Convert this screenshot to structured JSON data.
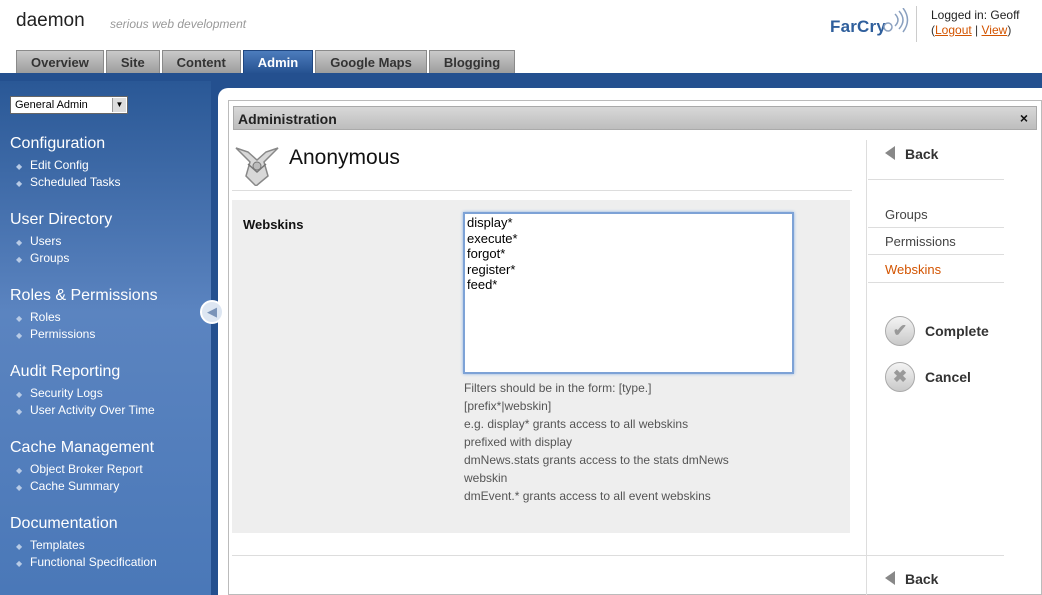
{
  "header": {
    "brand": "daemon",
    "tagline": "serious web development",
    "farcry_logo": "FarCry",
    "login": {
      "label": "Logged in: Geoff",
      "logout": "Logout",
      "view": "View"
    }
  },
  "tabs": [
    {
      "label": "Overview"
    },
    {
      "label": "Site"
    },
    {
      "label": "Content"
    },
    {
      "label": "Admin",
      "active": true
    },
    {
      "label": "Google Maps"
    },
    {
      "label": "Blogging"
    }
  ],
  "sidebar": {
    "select_value": "General Admin",
    "sections": [
      {
        "title": "Configuration",
        "items": [
          "Edit Config",
          "Scheduled Tasks"
        ]
      },
      {
        "title": "User Directory",
        "items": [
          "Users",
          "Groups"
        ]
      },
      {
        "title": "Roles & Permissions",
        "items": [
          "Roles",
          "Permissions"
        ]
      },
      {
        "title": "Audit Reporting",
        "items": [
          "Security Logs",
          "User Activity Over Time"
        ]
      },
      {
        "title": "Cache Management",
        "items": [
          "Object Broker Report",
          "Cache Summary"
        ]
      },
      {
        "title": "Documentation",
        "items": [
          "Templates",
          "Functional Specification"
        ]
      }
    ]
  },
  "admin": {
    "title": "Administration",
    "close": "×",
    "user_name": "Anonymous"
  },
  "form": {
    "field_label": "Webskins",
    "textarea_value": "display*\nexecute*\nforgot*\nregister*\nfeed*",
    "hint_lines": [
      "Filters should be in the form: [type.]",
      "[prefix*|webskin]",
      "e.g. display* grants access to all webskins",
      "prefixed with display",
      "dmNews.stats grants access to the stats dmNews",
      "webskin",
      "dmEvent.* grants access to all event webskins"
    ]
  },
  "right": {
    "back_label": "Back",
    "links": [
      {
        "label": "Groups"
      },
      {
        "label": "Permissions"
      },
      {
        "label": "Webskins",
        "active": true
      }
    ],
    "complete_label": "Complete",
    "cancel_label": "Cancel"
  },
  "colors": {
    "brand_blue": "#24508f",
    "accent_orange": "#d35400"
  }
}
